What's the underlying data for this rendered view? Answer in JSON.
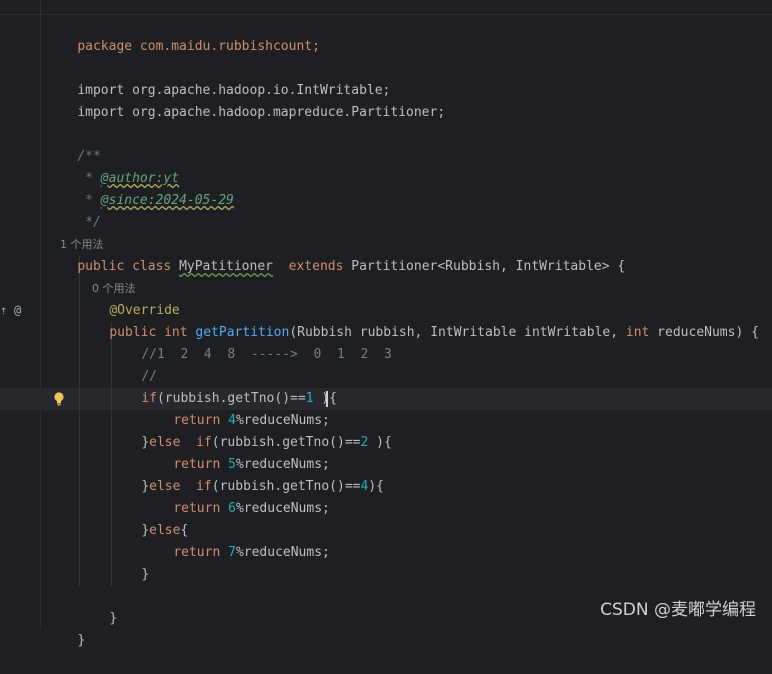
{
  "editor": {
    "lines": {
      "l1": "package com.maidu.rubbishcount;",
      "l2": "import org.apache.hadoop.io.IntWritable;",
      "l3": "import org.apache.hadoop.mapreduce.Partitioner;",
      "l4": "/**",
      "l5_star": " * ",
      "l5_tag": "@author:yt",
      "l6_star": " * ",
      "l6_tag": "@since:2024-05-29",
      "l7": " */",
      "usages1": "1 个用法",
      "cls_kw": "public class ",
      "cls_name": "MyPatitioner",
      "cls_rest_kw": "  extends ",
      "cls_rest": "Partitioner<Rubbish, IntWritable> {",
      "usages0": "0 个用法",
      "override": "@Override",
      "m_kw": "public int ",
      "m_name": "getPartition",
      "m_p1": "(Rubbish rubbish, IntWritable intWritable, ",
      "m_p2kw": "int",
      "m_p3": " reduceNums) {",
      "c1": "//1  2  4  8  ----->  0  1  2  3",
      "c2": "//",
      "if1_kw": "if",
      "if1_a": "(rubbish.getTno()==",
      "if1_n": "1",
      "if1_b": " ){",
      "r1_kw": "return ",
      "r1_n": "4",
      "r1_b": "%reduceNums;",
      "e1_a": "}",
      "e1_kw": "else  if",
      "e1_b": "(rubbish.getTno()==",
      "e1_n": "2",
      "e1_c": " ){",
      "r2_kw": "return ",
      "r2_n": "5",
      "r2_b": "%reduceNums;",
      "e2_a": "}",
      "e2_kw": "else  if",
      "e2_b": "(rubbish.getTno()==",
      "e2_n": "4",
      "e2_c": "){",
      "r3_kw": "return ",
      "r3_n": "6",
      "r3_b": "%reduceNums;",
      "e3_a": "}",
      "e3_kw": "else",
      "e3_b": "{",
      "r4_kw": "return ",
      "r4_n": "7",
      "r4_b": "%reduceNums;",
      "close1": "}",
      "close2": "}",
      "close3": "}"
    },
    "gutter_icons": {
      "implements": "⇡",
      "annotation": "@"
    }
  },
  "watermark": "CSDN @麦嘟学编程",
  "colors": {
    "background": "#1e1f22",
    "keyword": "#cf8e6d",
    "function": "#56a8f5",
    "number": "#2aacb8",
    "annotation": "#b3ae60",
    "doc": "#5f826b"
  }
}
